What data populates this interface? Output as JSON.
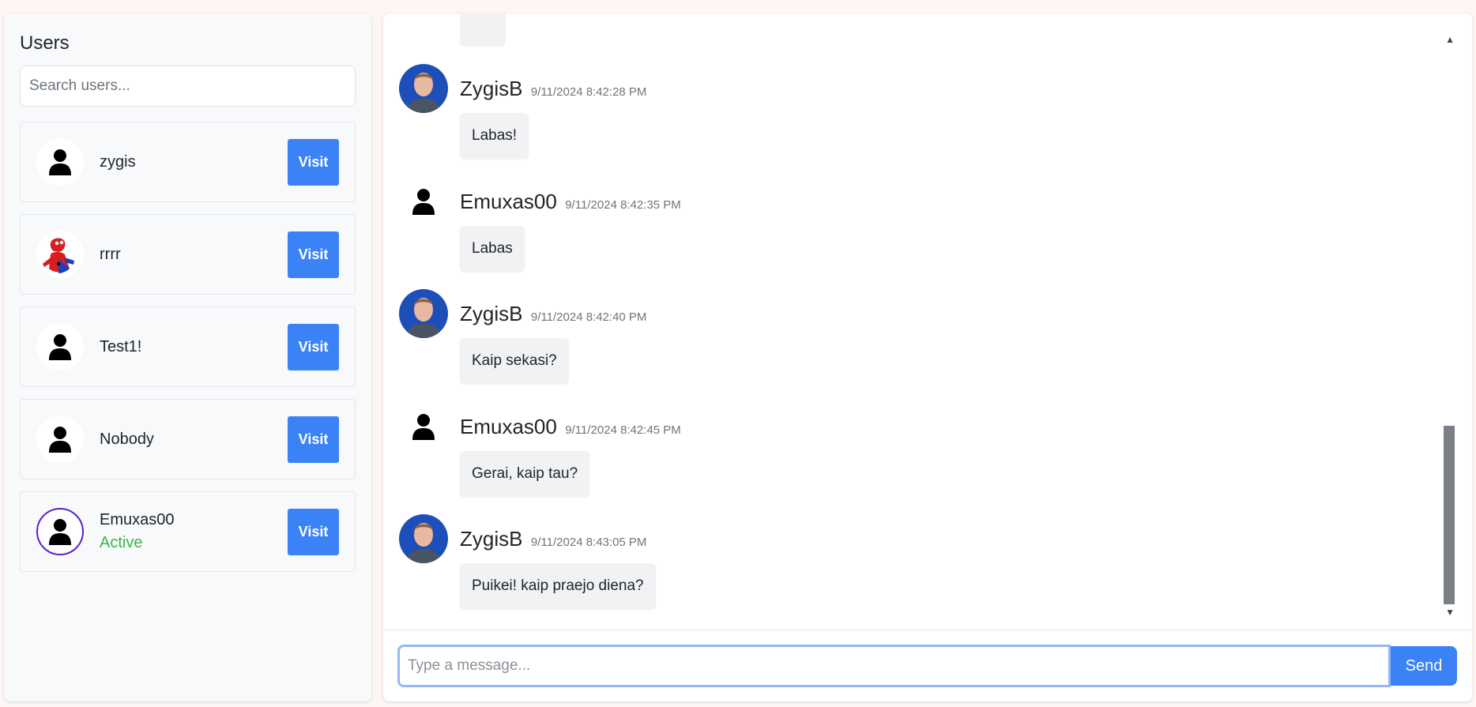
{
  "sidebar": {
    "title": "Users",
    "search_placeholder": "Search users...",
    "visit_label": "Visit",
    "users": [
      {
        "name": "zygis",
        "avatar": "person-icon",
        "status": ""
      },
      {
        "name": "rrrr",
        "avatar": "spider-avatar",
        "status": ""
      },
      {
        "name": "Test1!",
        "avatar": "person-icon",
        "status": ""
      },
      {
        "name": "Nobody",
        "avatar": "person-icon",
        "status": ""
      },
      {
        "name": "Emuxas00",
        "avatar": "person-icon",
        "status": "Active"
      }
    ]
  },
  "chat": {
    "messages": [
      {
        "author": "ZygisB",
        "time": "9/11/2024 8:42:28 PM",
        "text": "Labas!",
        "avatar": "photo-avatar"
      },
      {
        "author": "Emuxas00",
        "time": "9/11/2024 8:42:35 PM",
        "text": "Labas",
        "avatar": "person-icon"
      },
      {
        "author": "ZygisB",
        "time": "9/11/2024 8:42:40 PM",
        "text": "Kaip sekasi?",
        "avatar": "photo-avatar"
      },
      {
        "author": "Emuxas00",
        "time": "9/11/2024 8:42:45 PM",
        "text": "Gerai, kaip tau?",
        "avatar": "person-icon"
      },
      {
        "author": "ZygisB",
        "time": "9/11/2024 8:43:05 PM",
        "text": "Puikei! kaip praejo diena?",
        "avatar": "photo-avatar"
      }
    ],
    "input_placeholder": "Type a message...",
    "send_label": "Send"
  },
  "colors": {
    "accent": "#3b82f6",
    "active_status": "#3bb54a",
    "active_ring": "#5a1fd1"
  }
}
